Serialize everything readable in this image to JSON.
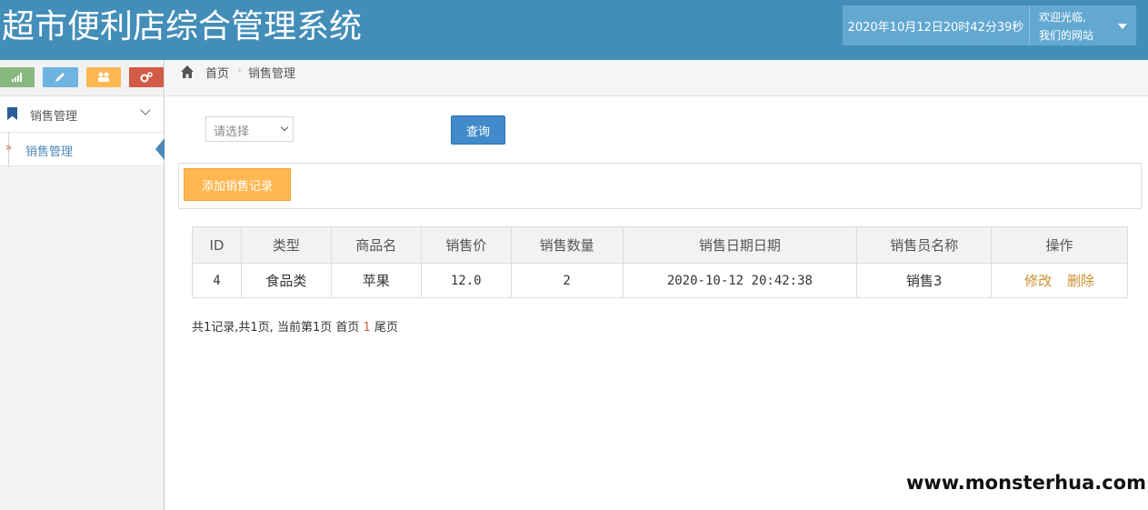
{
  "header": {
    "title": "超市便利店综合管理系统",
    "datetime": "2020年10月12日20时42分39秒",
    "welcome": "欢迎光临,",
    "site_name": "我们的网站"
  },
  "sidebar": {
    "shortcuts": [
      {
        "icon": "signal-icon",
        "color": "#87b87f"
      },
      {
        "icon": "pencil-icon",
        "color": "#6fb3e0"
      },
      {
        "icon": "users-icon",
        "color": "#ffb752"
      },
      {
        "icon": "cogs-icon",
        "color": "#d15b47"
      }
    ],
    "menu_group": "销售管理",
    "menu_item": "销售管理"
  },
  "breadcrumb": {
    "home": "首页",
    "separator": "›",
    "current": "销售管理"
  },
  "filter": {
    "select_value": "请选择",
    "search_label": "查询"
  },
  "actions": {
    "add_label": "添加销售记录"
  },
  "table": {
    "columns": [
      "ID",
      "类型",
      "商品名",
      "销售价",
      "销售数量",
      "销售日期日期",
      "销售员名称",
      "操作"
    ],
    "rows": [
      {
        "id": "4",
        "type": "食品类",
        "name": "苹果",
        "price": "12.0",
        "quantity": "2",
        "date": "2020-10-12 20:42:38",
        "seller": "销售3",
        "edit": "修改",
        "delete": "删除"
      }
    ]
  },
  "pager": {
    "prefix": "共1记录,共1页, 当前第1页 首页",
    "current_page": "1",
    "last": "尾页"
  },
  "watermark": "www.monsterhua.com",
  "colors": {
    "header_bg": "#438eb9",
    "primary": "#428bca",
    "warning": "#ffb752",
    "link_orange": "#c98f2e"
  }
}
